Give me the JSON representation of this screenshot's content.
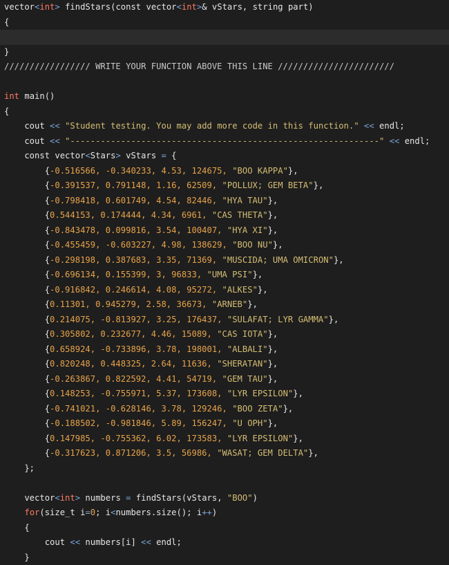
{
  "editor": {
    "lines": [
      {
        "tokens": [
          {
            "t": "vector",
            "c": "pl"
          },
          {
            "t": "<",
            "c": "op"
          },
          {
            "t": "int",
            "c": "type"
          },
          {
            "t": ">",
            "c": "op"
          },
          {
            "t": " findStars(",
            "c": "pl"
          },
          {
            "t": "const",
            "c": "pl"
          },
          {
            "t": " vector",
            "c": "pl"
          },
          {
            "t": "<",
            "c": "op"
          },
          {
            "t": "int",
            "c": "type"
          },
          {
            "t": ">",
            "c": "op"
          },
          {
            "t": "& vStars, string part)",
            "c": "pl"
          }
        ]
      },
      {
        "tokens": [
          {
            "t": "{",
            "c": "pl"
          }
        ]
      },
      {
        "tokens": [],
        "highlight": true
      },
      {
        "tokens": [
          {
            "t": "}",
            "c": "pl"
          }
        ]
      },
      {
        "tokens": [
          {
            "t": "///////////////// WRITE YOUR FUNCTION ABOVE THIS LINE ///////////////////////",
            "c": "cmt"
          }
        ]
      },
      {
        "tokens": []
      },
      {
        "tokens": [
          {
            "t": "int",
            "c": "type"
          },
          {
            "t": " main()",
            "c": "pl"
          }
        ]
      },
      {
        "tokens": [
          {
            "t": "{",
            "c": "pl"
          }
        ]
      },
      {
        "tokens": [
          {
            "t": "    cout ",
            "c": "pl"
          },
          {
            "t": "<<",
            "c": "op"
          },
          {
            "t": " ",
            "c": "pl"
          },
          {
            "t": "\"Student testing. You may add more code in this function.\"",
            "c": "str"
          },
          {
            "t": " ",
            "c": "pl"
          },
          {
            "t": "<<",
            "c": "op"
          },
          {
            "t": " endl;",
            "c": "pl"
          }
        ]
      },
      {
        "tokens": [
          {
            "t": "    cout ",
            "c": "pl"
          },
          {
            "t": "<<",
            "c": "op"
          },
          {
            "t": " ",
            "c": "pl"
          },
          {
            "t": "\"-------------------------------------------------------------\"",
            "c": "str"
          },
          {
            "t": " ",
            "c": "pl"
          },
          {
            "t": "<<",
            "c": "op"
          },
          {
            "t": " endl;",
            "c": "pl"
          }
        ]
      },
      {
        "tokens": [
          {
            "t": "    const",
            "c": "pl"
          },
          {
            "t": " vector",
            "c": "pl"
          },
          {
            "t": "<",
            "c": "op"
          },
          {
            "t": "Stars",
            "c": "pl"
          },
          {
            "t": ">",
            "c": "op"
          },
          {
            "t": " vStars ",
            "c": "pl"
          },
          {
            "t": "=",
            "c": "op"
          },
          {
            "t": " {",
            "c": "pl"
          }
        ]
      },
      {
        "tokens": [
          {
            "t": "        {",
            "c": "pl"
          },
          {
            "t": "-0.516566, -0.340233, 4.53, 124675, ",
            "c": "num"
          },
          {
            "t": "\"BOO KAPPA\"",
            "c": "str"
          },
          {
            "t": "},",
            "c": "pl"
          }
        ]
      },
      {
        "tokens": [
          {
            "t": "        {",
            "c": "pl"
          },
          {
            "t": "-0.391537, 0.791148, 1.16, 62509, ",
            "c": "num"
          },
          {
            "t": "\"POLLUX; GEM BETA\"",
            "c": "str"
          },
          {
            "t": "},",
            "c": "pl"
          }
        ]
      },
      {
        "tokens": [
          {
            "t": "        {",
            "c": "pl"
          },
          {
            "t": "-0.798418, 0.601749, 4.54, 82446, ",
            "c": "num"
          },
          {
            "t": "\"HYA TAU\"",
            "c": "str"
          },
          {
            "t": "},",
            "c": "pl"
          }
        ]
      },
      {
        "tokens": [
          {
            "t": "        {",
            "c": "pl"
          },
          {
            "t": "0.544153, 0.174444, 4.34, 6961, ",
            "c": "num"
          },
          {
            "t": "\"CAS THETA\"",
            "c": "str"
          },
          {
            "t": "},",
            "c": "pl"
          }
        ]
      },
      {
        "tokens": [
          {
            "t": "        {",
            "c": "pl"
          },
          {
            "t": "-0.843478, 0.099816, 3.54, 100407, ",
            "c": "num"
          },
          {
            "t": "\"HYA XI\"",
            "c": "str"
          },
          {
            "t": "},",
            "c": "pl"
          }
        ]
      },
      {
        "tokens": [
          {
            "t": "        {",
            "c": "pl"
          },
          {
            "t": "-0.455459, -0.603227, 4.98, 138629, ",
            "c": "num"
          },
          {
            "t": "\"BOO NU\"",
            "c": "str"
          },
          {
            "t": "},",
            "c": "pl"
          }
        ]
      },
      {
        "tokens": [
          {
            "t": "        {",
            "c": "pl"
          },
          {
            "t": "-0.298198, 0.387683, 3.35, 71369, ",
            "c": "num"
          },
          {
            "t": "\"MUSCIDA; UMA OMICRON\"",
            "c": "str"
          },
          {
            "t": "},",
            "c": "pl"
          }
        ]
      },
      {
        "tokens": [
          {
            "t": "        {",
            "c": "pl"
          },
          {
            "t": "-0.696134, 0.155399, 3, 96833, ",
            "c": "num"
          },
          {
            "t": "\"UMA PSI\"",
            "c": "str"
          },
          {
            "t": "},",
            "c": "pl"
          }
        ]
      },
      {
        "tokens": [
          {
            "t": "        {",
            "c": "pl"
          },
          {
            "t": "-0.916842, 0.246614, 4.08, 95272, ",
            "c": "num"
          },
          {
            "t": "\"ALKES\"",
            "c": "str"
          },
          {
            "t": "},",
            "c": "pl"
          }
        ]
      },
      {
        "tokens": [
          {
            "t": "        {",
            "c": "pl"
          },
          {
            "t": "0.11301, 0.945279, 2.58, 36673, ",
            "c": "num"
          },
          {
            "t": "\"ARNEB\"",
            "c": "str"
          },
          {
            "t": "},",
            "c": "pl"
          }
        ]
      },
      {
        "tokens": [
          {
            "t": "        {",
            "c": "pl"
          },
          {
            "t": "0.214075, -0.813927, 3.25, 176437, ",
            "c": "num"
          },
          {
            "t": "\"SULAFAT; LYR GAMMA\"",
            "c": "str"
          },
          {
            "t": "},",
            "c": "pl"
          }
        ]
      },
      {
        "tokens": [
          {
            "t": "        {",
            "c": "pl"
          },
          {
            "t": "0.305802, 0.232677, 4.46, 15089, ",
            "c": "num"
          },
          {
            "t": "\"CAS IOTA\"",
            "c": "str"
          },
          {
            "t": "},",
            "c": "pl"
          }
        ]
      },
      {
        "tokens": [
          {
            "t": "        {",
            "c": "pl"
          },
          {
            "t": "0.658924, -0.733896, 3.78, 198001, ",
            "c": "num"
          },
          {
            "t": "\"ALBALI\"",
            "c": "str"
          },
          {
            "t": "},",
            "c": "pl"
          }
        ]
      },
      {
        "tokens": [
          {
            "t": "        {",
            "c": "pl"
          },
          {
            "t": "0.820248, 0.448325, 2.64, 11636, ",
            "c": "num"
          },
          {
            "t": "\"SHERATAN\"",
            "c": "str"
          },
          {
            "t": "},",
            "c": "pl"
          }
        ]
      },
      {
        "tokens": [
          {
            "t": "        {",
            "c": "pl"
          },
          {
            "t": "-0.263867, 0.822592, 4.41, 54719, ",
            "c": "num"
          },
          {
            "t": "\"GEM TAU\"",
            "c": "str"
          },
          {
            "t": "},",
            "c": "pl"
          }
        ]
      },
      {
        "tokens": [
          {
            "t": "        {",
            "c": "pl"
          },
          {
            "t": "0.148253, -0.755971, 5.37, 173608, ",
            "c": "num"
          },
          {
            "t": "\"LYR EPSILON\"",
            "c": "str"
          },
          {
            "t": "},",
            "c": "pl"
          }
        ]
      },
      {
        "tokens": [
          {
            "t": "        {",
            "c": "pl"
          },
          {
            "t": "-0.741021, -0.628146, 3.78, 129246, ",
            "c": "num"
          },
          {
            "t": "\"BOO ZETA\"",
            "c": "str"
          },
          {
            "t": "},",
            "c": "pl"
          }
        ]
      },
      {
        "tokens": [
          {
            "t": "        {",
            "c": "pl"
          },
          {
            "t": "-0.188502, -0.981846, 5.89, 156247, ",
            "c": "num"
          },
          {
            "t": "\"U OPH\"",
            "c": "str"
          },
          {
            "t": "},",
            "c": "pl"
          }
        ]
      },
      {
        "tokens": [
          {
            "t": "        {",
            "c": "pl"
          },
          {
            "t": "0.147985, -0.755362, 6.02, 173583, ",
            "c": "num"
          },
          {
            "t": "\"LYR EPSILON\"",
            "c": "str"
          },
          {
            "t": "},",
            "c": "pl"
          }
        ]
      },
      {
        "tokens": [
          {
            "t": "        {",
            "c": "pl"
          },
          {
            "t": "-0.317623, 0.871206, 3.5, 56986, ",
            "c": "num"
          },
          {
            "t": "\"WASAT; GEM DELTA\"",
            "c": "str"
          },
          {
            "t": "},",
            "c": "pl"
          }
        ]
      },
      {
        "tokens": [
          {
            "t": "    };",
            "c": "pl"
          }
        ]
      },
      {
        "tokens": []
      },
      {
        "tokens": [
          {
            "t": "    vector",
            "c": "pl"
          },
          {
            "t": "<",
            "c": "op"
          },
          {
            "t": "int",
            "c": "type"
          },
          {
            "t": ">",
            "c": "op"
          },
          {
            "t": " numbers ",
            "c": "pl"
          },
          {
            "t": "=",
            "c": "op"
          },
          {
            "t": " findStars(vStars, ",
            "c": "pl"
          },
          {
            "t": "\"BOO\"",
            "c": "str"
          },
          {
            "t": ")",
            "c": "pl"
          }
        ]
      },
      {
        "tokens": [
          {
            "t": "    ",
            "c": "pl"
          },
          {
            "t": "for",
            "c": "type"
          },
          {
            "t": "(size_t i",
            "c": "pl"
          },
          {
            "t": "=",
            "c": "op"
          },
          {
            "t": "0",
            "c": "num"
          },
          {
            "t": "; i",
            "c": "pl"
          },
          {
            "t": "<",
            "c": "op"
          },
          {
            "t": "numbers.size(); i",
            "c": "pl"
          },
          {
            "t": "++",
            "c": "op"
          },
          {
            "t": ")",
            "c": "pl"
          }
        ]
      },
      {
        "tokens": [
          {
            "t": "    {",
            "c": "pl"
          }
        ]
      },
      {
        "tokens": [
          {
            "t": "        cout ",
            "c": "pl"
          },
          {
            "t": "<<",
            "c": "op"
          },
          {
            "t": " numbers[i] ",
            "c": "pl"
          },
          {
            "t": "<<",
            "c": "op"
          },
          {
            "t": " endl;",
            "c": "pl"
          }
        ]
      },
      {
        "tokens": [
          {
            "t": "    }",
            "c": "pl"
          }
        ]
      }
    ]
  }
}
